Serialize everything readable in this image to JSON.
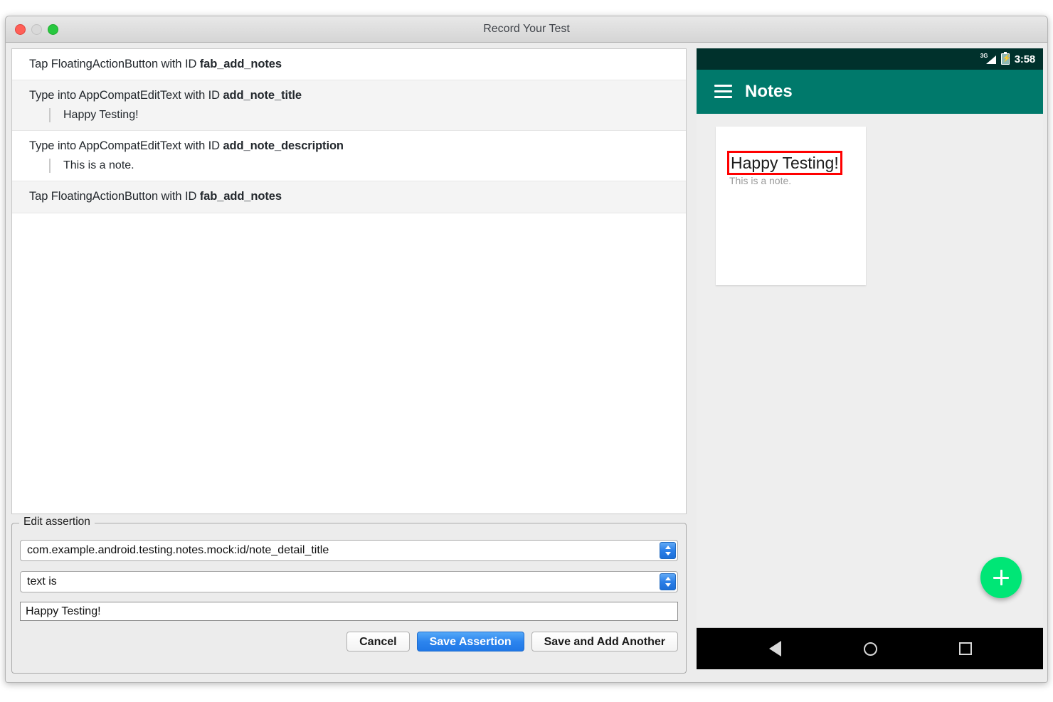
{
  "window": {
    "title": "Record Your Test",
    "traffic_lights": [
      "close",
      "minimize",
      "maximize"
    ]
  },
  "steps": [
    {
      "action": "Tap FloatingActionButton with ID ",
      "target_id": "fab_add_notes",
      "value": null,
      "stripe": "odd"
    },
    {
      "action": "Type into AppCompatEditText with ID ",
      "target_id": "add_note_title",
      "value": "Happy Testing!",
      "stripe": "even"
    },
    {
      "action": "Type into AppCompatEditText with ID ",
      "target_id": "add_note_description",
      "value": "This is a note.",
      "stripe": "odd"
    },
    {
      "action": "Tap FloatingActionButton with ID ",
      "target_id": "fab_add_notes",
      "value": null,
      "stripe": "even"
    }
  ],
  "assertion": {
    "legend": "Edit assertion",
    "resource_id_value": "com.example.android.testing.notes.mock:id/note_detail_title",
    "matcher_value": "text is",
    "text_value": "Happy Testing!",
    "buttons": {
      "cancel": "Cancel",
      "save": "Save Assertion",
      "save_add_another": "Save and Add Another"
    }
  },
  "device": {
    "statusbar": {
      "network_label": "3G",
      "clock": "3:58",
      "battery_glyph": "⚡"
    },
    "appbar": {
      "title": "Notes"
    },
    "note_card": {
      "title": "Happy Testing!",
      "description": "This is a note.",
      "highlight_color": "#ff0000"
    },
    "fab": {
      "label": "+",
      "color": "#00e676"
    },
    "navbar": {
      "back": "back",
      "home": "home",
      "recents": "recents"
    }
  },
  "colors": {
    "appbar_teal": "#00796b",
    "statusbar_teal": "#00312c",
    "primary_button_blue": "#2c85ee",
    "highlight_red": "#ff0000",
    "fab_green": "#00e676"
  }
}
